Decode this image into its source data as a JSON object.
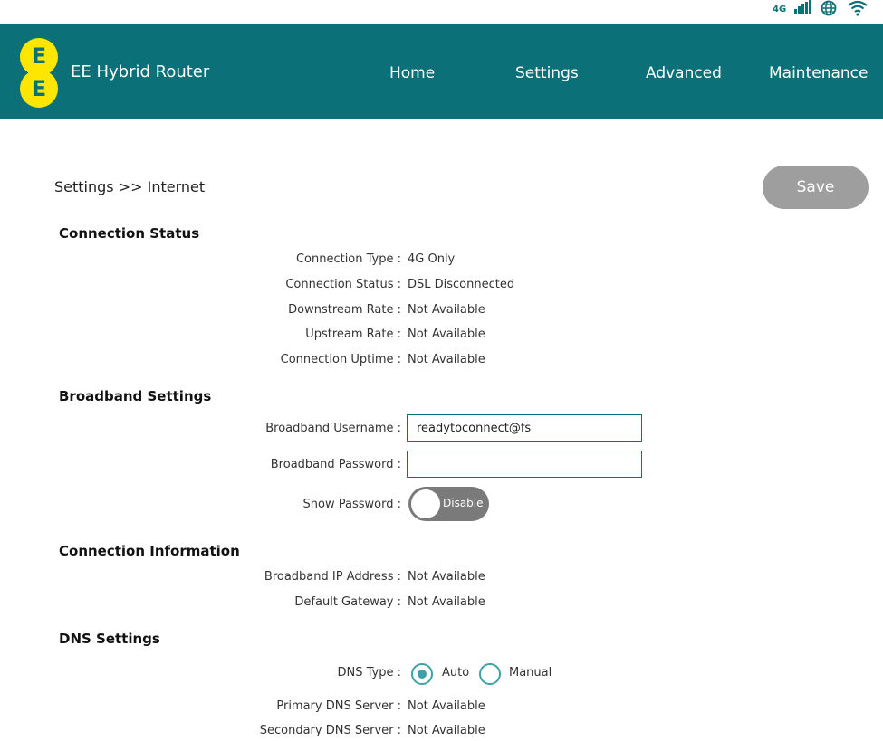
{
  "statusbar": {
    "network_type": "4G",
    "icons": [
      "signal-bars-icon",
      "globe-icon",
      "wifi-icon"
    ]
  },
  "header": {
    "logo_letters": [
      "E",
      "E"
    ],
    "brand": "EE Hybrid Router",
    "nav": [
      "Home",
      "Settings",
      "Advanced",
      "Maintenance"
    ],
    "colors": {
      "background": "#0b7077",
      "logo": "#ffe600"
    }
  },
  "page": {
    "breadcrumb": "Settings >> Internet",
    "save_label": "Save"
  },
  "connection_status": {
    "title": "Connection Status",
    "rows": [
      {
        "label": "Connection Type :",
        "value": "4G Only"
      },
      {
        "label": "Connection Status :",
        "value": "DSL Disconnected"
      },
      {
        "label": "Downstream Rate :",
        "value": "Not Available"
      },
      {
        "label": "Upstream Rate :",
        "value": "Not Available"
      },
      {
        "label": "Connection Uptime :",
        "value": "Not Available"
      }
    ]
  },
  "broadband": {
    "title": "Broadband Settings",
    "username_label": "Broadband Username :",
    "username_value": "readytoconnect@fs",
    "password_label": "Broadband Password :",
    "password_value": "",
    "show_password_label": "Show Password :",
    "show_password_state": "Disable"
  },
  "connection_info": {
    "title": "Connection Information",
    "rows": [
      {
        "label": "Broadband IP Address :",
        "value": "Not Available"
      },
      {
        "label": "Default Gateway :",
        "value": "Not Available"
      }
    ]
  },
  "dns": {
    "title": "DNS Settings",
    "type_label": "DNS Type :",
    "options": [
      "Auto",
      "Manual"
    ],
    "selected": "Auto",
    "rows": [
      {
        "label": "Primary DNS Server :",
        "value": "Not Available"
      },
      {
        "label": "Secondary DNS Server :",
        "value": "Not Available"
      }
    ]
  }
}
